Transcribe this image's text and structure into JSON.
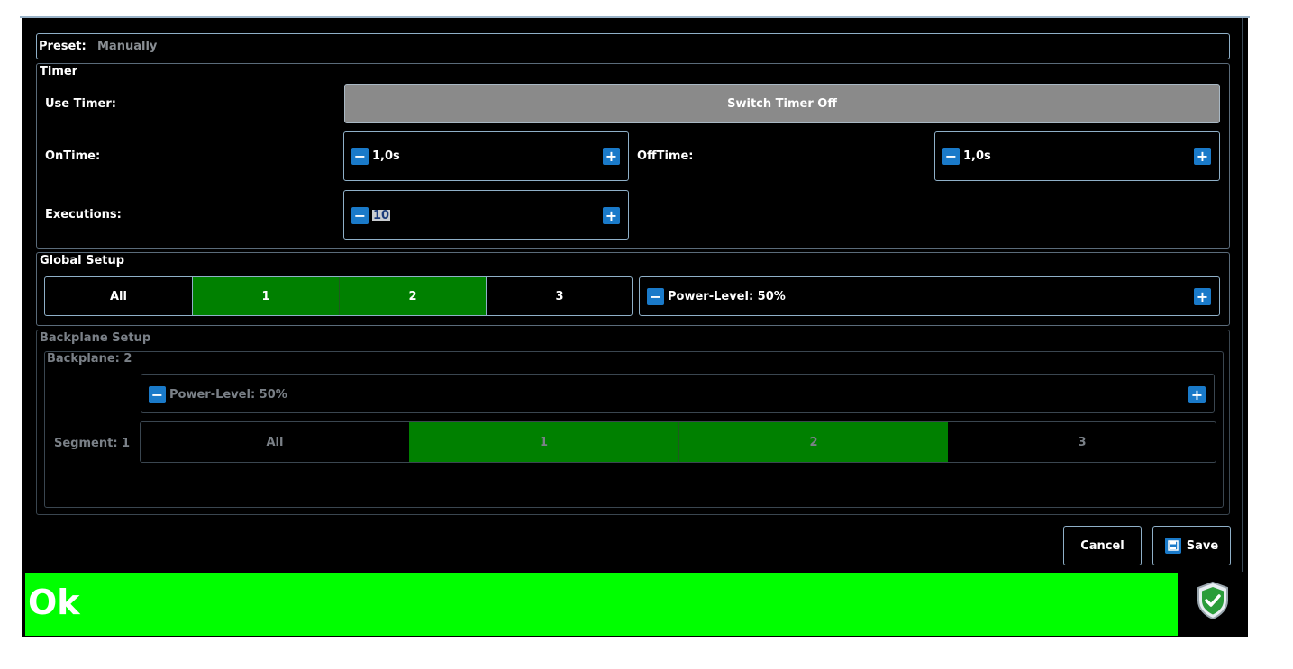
{
  "preset": {
    "label": "Preset:",
    "value": "Manually"
  },
  "timer": {
    "title": "Timer",
    "use_timer_label": "Use Timer:",
    "switch_button": "Switch Timer Off",
    "on_time_label": "OnTime:",
    "on_time_value": "1,0s",
    "off_time_label": "OffTime:",
    "off_time_value": "1,0s",
    "executions_label": "Executions:",
    "executions_value": "10"
  },
  "global": {
    "title": "Global Setup",
    "segments": [
      "All",
      "1",
      "2",
      "3"
    ],
    "selected": [
      "1",
      "2"
    ],
    "power_level": "Power-Level: 50%"
  },
  "backplane": {
    "title": "Backplane Setup",
    "subtitle": "Backplane: 2",
    "power_level": "Power-Level: 50%",
    "segment_label": "Segment: 1",
    "segments": [
      "All",
      "1",
      "2",
      "3"
    ],
    "selected": [
      "1",
      "2"
    ]
  },
  "actions": {
    "cancel": "Cancel",
    "save": "Save"
  },
  "status": {
    "text": "Ok",
    "color": "#00ff00",
    "icon": "shield-check-icon"
  },
  "icons": {
    "minus": "−",
    "plus": "+"
  },
  "colors": {
    "selected_segment": "#008000",
    "stepper_button": "#1a7ac9",
    "switch_button": "#8a8a8a"
  }
}
